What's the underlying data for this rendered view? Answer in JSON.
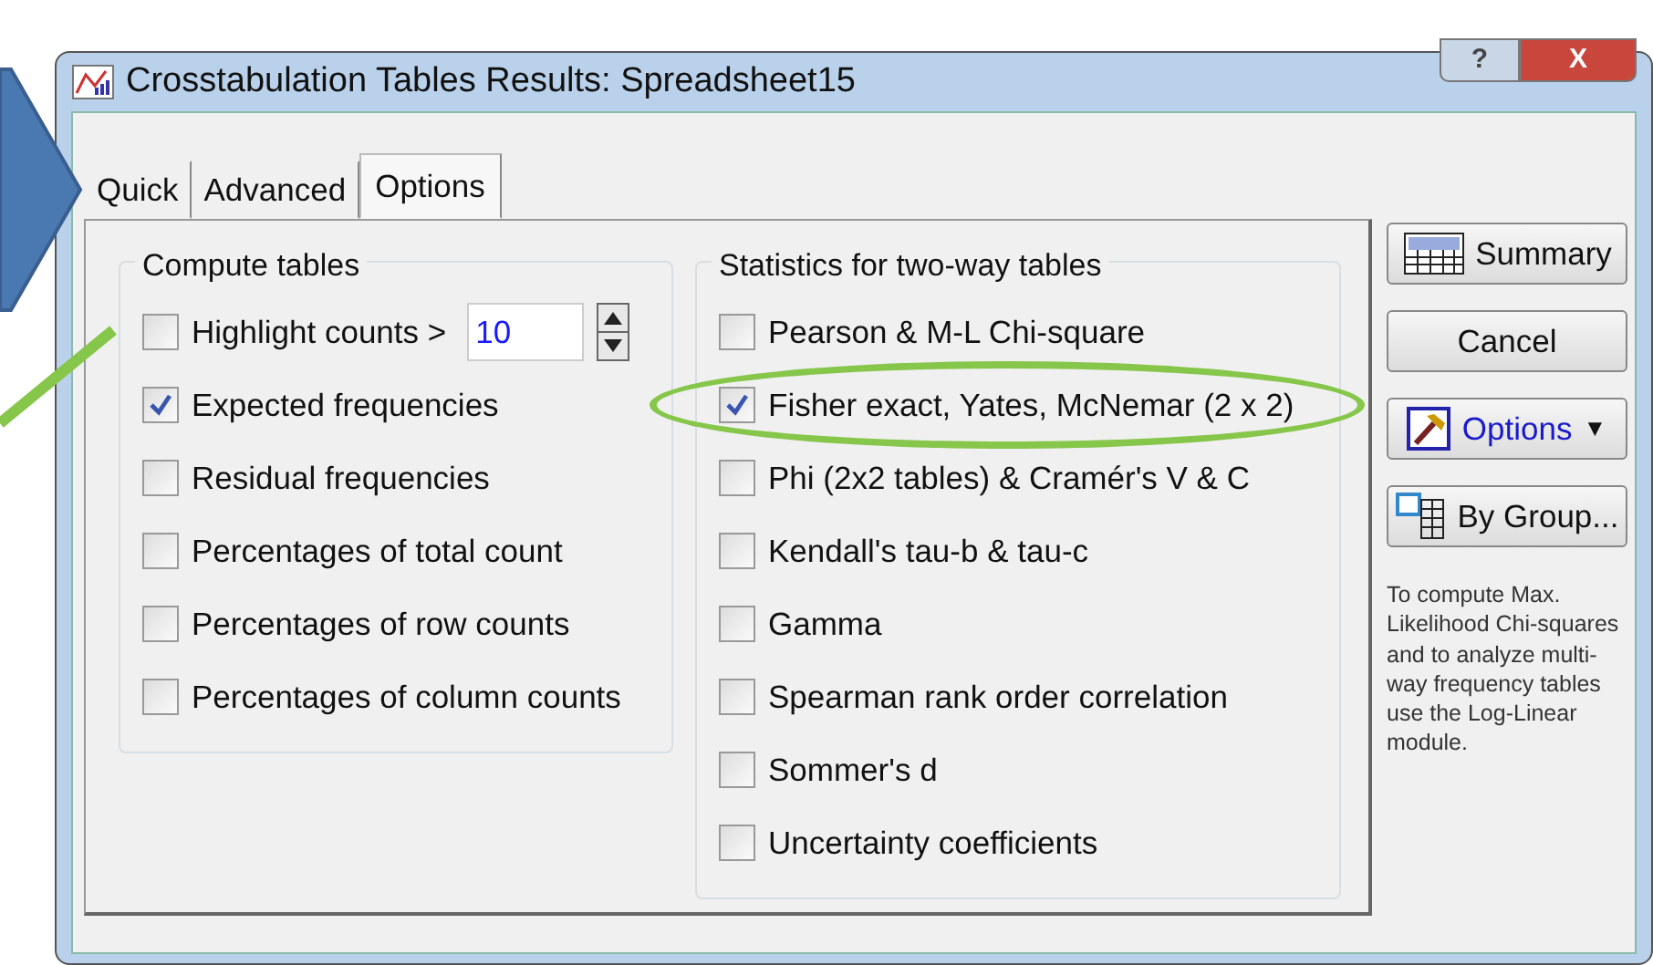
{
  "window": {
    "title": "Crosstabulation Tables Results: Spreadsheet15",
    "controls": [
      {
        "kind": "help",
        "label": "?"
      },
      {
        "kind": "close",
        "label": "X"
      }
    ]
  },
  "tabs": [
    {
      "label": "Quick",
      "selected": false
    },
    {
      "label": "Advanced",
      "selected": false
    },
    {
      "label": "Options",
      "selected": true
    }
  ],
  "compute_tables": {
    "title": "Compute tables",
    "items": [
      {
        "kind": "spin",
        "label": "Highlight counts >",
        "checked": false,
        "value": "10"
      },
      {
        "kind": "check",
        "label": "Expected frequencies",
        "checked": true
      },
      {
        "kind": "check",
        "label": "Residual frequencies",
        "checked": false
      },
      {
        "kind": "check",
        "label": "Percentages of total count",
        "checked": false
      },
      {
        "kind": "check",
        "label": "Percentages of row counts",
        "checked": false
      },
      {
        "kind": "check",
        "label": "Percentages of column counts",
        "checked": false
      }
    ]
  },
  "statistics": {
    "title": "Statistics for two-way tables",
    "items": [
      {
        "label": "Pearson & M-L Chi-square",
        "checked": false,
        "highlighted": false
      },
      {
        "label": "Fisher exact, Yates, McNemar (2 x 2)",
        "checked": true,
        "highlighted": true
      },
      {
        "label": "Phi (2x2 tables) & Cramér's V &  C",
        "checked": false,
        "highlighted": false
      },
      {
        "label": "Kendall's tau-b & tau-c",
        "checked": false,
        "highlighted": false
      },
      {
        "label": "Gamma",
        "checked": false,
        "highlighted": false
      },
      {
        "label": "Spearman rank order correlation",
        "checked": false,
        "highlighted": false
      },
      {
        "label": "Sommer's d",
        "checked": false,
        "highlighted": false
      },
      {
        "label": "Uncertainty coefficients",
        "checked": false,
        "highlighted": false
      }
    ]
  },
  "side_buttons": [
    {
      "kind": "summary",
      "label": "Summary"
    },
    {
      "kind": "plain",
      "label": "Cancel"
    },
    {
      "kind": "options",
      "label": "Options",
      "caret": "▼"
    },
    {
      "kind": "bygroup",
      "label": "By Group..."
    }
  ],
  "note": "To compute Max. Likelihood Chi-squares and to analyze multi-way frequency tables use the Log-Linear module."
}
